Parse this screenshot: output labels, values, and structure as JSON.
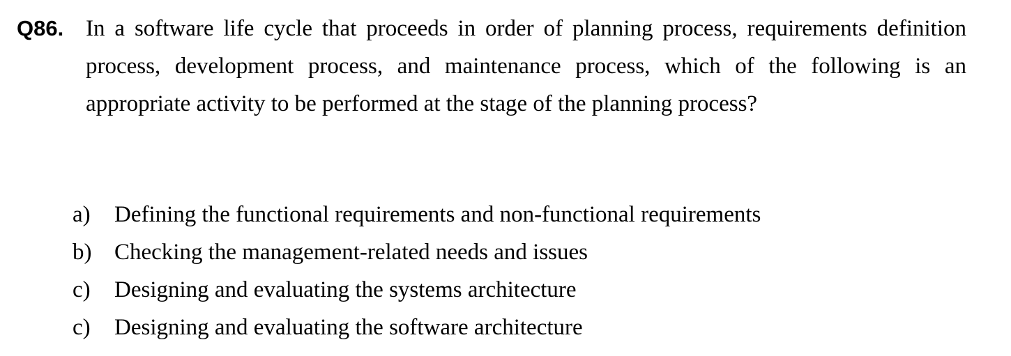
{
  "question": {
    "number": "Q86.",
    "text": "In a software life cycle that proceeds in order of planning process, requirements definition process, development process, and maintenance process, which of the following is an appropriate activity to be performed at the stage of the planning process?"
  },
  "options": [
    {
      "letter": "a)",
      "text": "Defining the functional requirements and non-functional requirements"
    },
    {
      "letter": "b)",
      "text": "Checking the management-related needs and issues"
    },
    {
      "letter": "c)",
      "text": "Designing and evaluating the systems architecture"
    },
    {
      "letter": "c)",
      "text": "Designing and evaluating the software architecture"
    }
  ]
}
